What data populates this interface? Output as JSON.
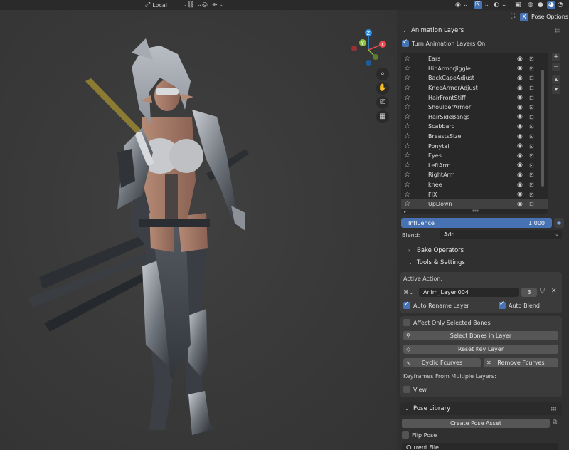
{
  "header": {
    "transform_orientation": "Local",
    "pose_options_tab": "Pose Options",
    "x_button": "X"
  },
  "animation_layers": {
    "title": "Animation Layers",
    "turn_on_label": "Turn Animation Layers On",
    "turn_on_checked": true,
    "layers": [
      {
        "name": "Ears"
      },
      {
        "name": "HipArmorJiggle"
      },
      {
        "name": "BackCapeAdjust"
      },
      {
        "name": "KneeArmorAdjust"
      },
      {
        "name": "HairFrontStiff"
      },
      {
        "name": "ShoulderArmor"
      },
      {
        "name": "HairSideBangs"
      },
      {
        "name": "Scabbard"
      },
      {
        "name": "BreastsSize"
      },
      {
        "name": "Ponytail"
      },
      {
        "name": "Eyes"
      },
      {
        "name": "LeftArm"
      },
      {
        "name": "RightArm"
      },
      {
        "name": "knee"
      },
      {
        "name": "FIX"
      },
      {
        "name": "UpDown"
      }
    ],
    "selected_layer": "UpDown",
    "influence_label": "Influence",
    "influence_value": "1.000",
    "blend_label": "Blend:",
    "blend_value": "Add",
    "bake_operators": "Bake Operators",
    "tools_settings": "Tools & Settings"
  },
  "tools": {
    "active_action_label": "Active Action:",
    "action_name": "Anim_Layer.004",
    "action_users": "3",
    "auto_rename_label": "Auto Rename Layer",
    "auto_rename_checked": true,
    "auto_blend_label": "Auto Blend",
    "auto_blend_checked": true,
    "affect_selected_label": "Affect Only Selected Bones",
    "select_bones_button": "Select Bones in Layer",
    "reset_key_button": "Reset Key Layer",
    "cyclic_button": "Cyclic Fcurves",
    "remove_button": "Remove Fcurves",
    "keyframes_label": "Keyframes From Multiple Layers:",
    "view_label": "View"
  },
  "pose_library": {
    "title": "Pose Library",
    "create_button": "Create Pose Asset",
    "flip_label": "Flip Pose",
    "current_file": "Current File"
  },
  "gizmo": {
    "axes": [
      "X",
      "Y",
      "Z"
    ],
    "colors": {
      "x": "#e8484f",
      "y": "#8bc43f",
      "z": "#2f8fe8"
    }
  }
}
